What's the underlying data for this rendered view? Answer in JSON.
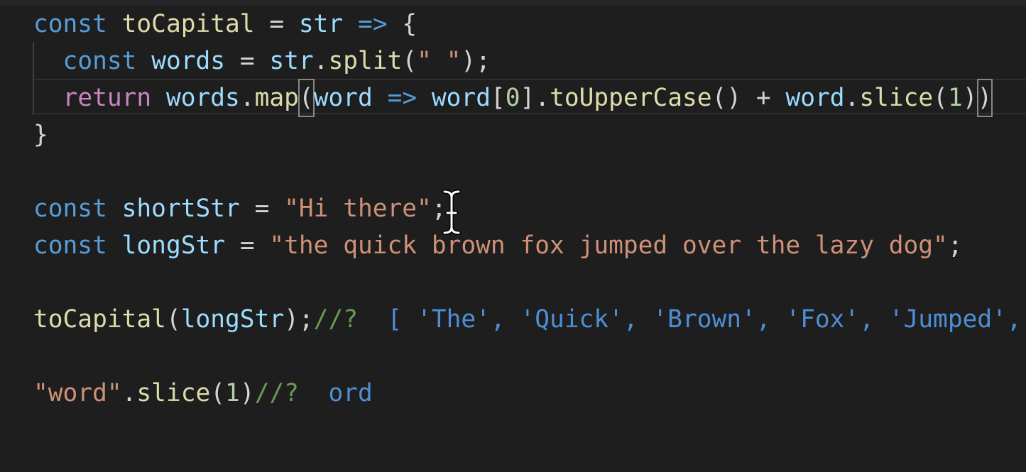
{
  "editor": {
    "lines": [
      {
        "tokens": [
          {
            "t": "const",
            "c": "kw"
          },
          {
            "t": " ",
            "c": "op"
          },
          {
            "t": "toCapital",
            "c": "fn"
          },
          {
            "t": " = ",
            "c": "op"
          },
          {
            "t": "str",
            "c": "var"
          },
          {
            "t": " ",
            "c": "op"
          },
          {
            "t": "=>",
            "c": "kw"
          },
          {
            "t": " {",
            "c": "op"
          }
        ]
      },
      {
        "tokens": [
          {
            "t": "  ",
            "c": "op"
          },
          {
            "t": "const",
            "c": "kw"
          },
          {
            "t": " ",
            "c": "op"
          },
          {
            "t": "words",
            "c": "var"
          },
          {
            "t": " = ",
            "c": "op"
          },
          {
            "t": "str",
            "c": "var"
          },
          {
            "t": ".",
            "c": "op"
          },
          {
            "t": "split",
            "c": "fn"
          },
          {
            "t": "(",
            "c": "op"
          },
          {
            "t": "\" \"",
            "c": "str"
          },
          {
            "t": ");",
            "c": "op"
          }
        ]
      },
      {
        "tokens": [
          {
            "t": "  ",
            "c": "op"
          },
          {
            "t": "return",
            "c": "ctrl"
          },
          {
            "t": " ",
            "c": "op"
          },
          {
            "t": "words",
            "c": "var"
          },
          {
            "t": ".",
            "c": "op"
          },
          {
            "t": "map",
            "c": "fn"
          },
          {
            "t": "(",
            "c": "op",
            "box": true
          },
          {
            "t": "word",
            "c": "var"
          },
          {
            "t": " ",
            "c": "op"
          },
          {
            "t": "=>",
            "c": "kw"
          },
          {
            "t": " ",
            "c": "op"
          },
          {
            "t": "word",
            "c": "var"
          },
          {
            "t": "[",
            "c": "op"
          },
          {
            "t": "0",
            "c": "num"
          },
          {
            "t": "].",
            "c": "op"
          },
          {
            "t": "toUpperCase",
            "c": "fn"
          },
          {
            "t": "() + ",
            "c": "op"
          },
          {
            "t": "word",
            "c": "var"
          },
          {
            "t": ".",
            "c": "op"
          },
          {
            "t": "slice",
            "c": "fn"
          },
          {
            "t": "(",
            "c": "op"
          },
          {
            "t": "1",
            "c": "num"
          },
          {
            "t": ")",
            "c": "op"
          },
          {
            "t": ")",
            "c": "op",
            "box": true
          }
        ]
      },
      {
        "tokens": [
          {
            "t": "}",
            "c": "op"
          }
        ]
      },
      {
        "tokens": []
      },
      {
        "tokens": [
          {
            "t": "const",
            "c": "kw"
          },
          {
            "t": " ",
            "c": "op"
          },
          {
            "t": "shortStr",
            "c": "var"
          },
          {
            "t": " = ",
            "c": "op"
          },
          {
            "t": "\"Hi there\"",
            "c": "str"
          },
          {
            "t": ";",
            "c": "op"
          }
        ]
      },
      {
        "tokens": [
          {
            "t": "const",
            "c": "kw"
          },
          {
            "t": " ",
            "c": "op"
          },
          {
            "t": "longStr",
            "c": "var"
          },
          {
            "t": " = ",
            "c": "op"
          },
          {
            "t": "\"the quick brown fox jumped over the lazy dog\"",
            "c": "str"
          },
          {
            "t": ";",
            "c": "op"
          }
        ]
      },
      {
        "tokens": []
      },
      {
        "tokens": [
          {
            "t": "toCapital",
            "c": "fn"
          },
          {
            "t": "(",
            "c": "op"
          },
          {
            "t": "longStr",
            "c": "var"
          },
          {
            "t": ");",
            "c": "op"
          },
          {
            "t": "//?",
            "c": "cmt"
          },
          {
            "t": "  [ 'The', 'Quick', 'Brown', 'Fox', 'Jumped', 'Over', 'The', 'Lazy', 'Dog' ]",
            "c": "res"
          }
        ]
      },
      {
        "tokens": []
      },
      {
        "tokens": [
          {
            "t": "\"word\"",
            "c": "str"
          },
          {
            "t": ".",
            "c": "op"
          },
          {
            "t": "slice",
            "c": "fn"
          },
          {
            "t": "(",
            "c": "op"
          },
          {
            "t": "1",
            "c": "num"
          },
          {
            "t": ")",
            "c": "op"
          },
          {
            "t": "//?",
            "c": "cmt"
          },
          {
            "t": "  ord",
            "c": "res"
          }
        ]
      }
    ]
  }
}
